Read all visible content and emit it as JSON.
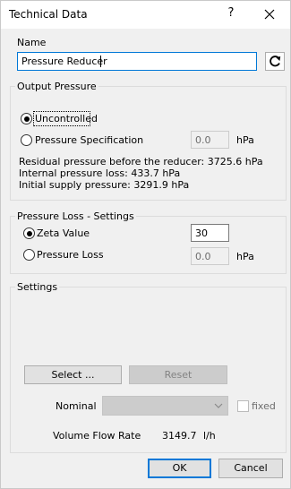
{
  "window": {
    "title": "Technical Data",
    "help_glyph": "?"
  },
  "name_section": {
    "label": "Name",
    "value": "Pressure Reducer"
  },
  "output_pressure": {
    "legend": "Output Pressure",
    "uncontrolled_label": "Uncontrolled",
    "pressure_spec_label": "Pressure Specification",
    "pressure_spec_value": "0.0",
    "pressure_spec_unit": "hPa",
    "residual_line": "Residual pressure before the reducer: 3725.6 hPa",
    "internal_loss_line": "Internal pressure loss: 433.7 hPa",
    "supply_line": "Initial supply pressure: 3291.9 hPa",
    "selected": "Uncontrolled"
  },
  "pressure_loss": {
    "legend": "Pressure Loss - Settings",
    "zeta_label": "Zeta Value",
    "zeta_value": "30",
    "loss_label": "Pressure Loss",
    "loss_value": "0.0",
    "loss_unit": "hPa",
    "selected": "Zeta Value"
  },
  "settings": {
    "legend": "Settings",
    "select_button": "Select ...",
    "reset_button": "Reset",
    "nominal_label": "Nominal",
    "nominal_value": "",
    "fixed_label": "fixed",
    "flow_label": "Volume Flow Rate",
    "flow_value": "3149.7",
    "flow_unit": "l/h"
  },
  "buttons": {
    "ok": "OK",
    "cancel": "Cancel"
  },
  "icons": {
    "refresh": "refresh-icon",
    "close": "close-icon",
    "dropdown": "chevron-down-icon"
  },
  "colors": {
    "accent": "#0078d7",
    "background": "#f0f0f0",
    "disabled": "#cccccc"
  }
}
